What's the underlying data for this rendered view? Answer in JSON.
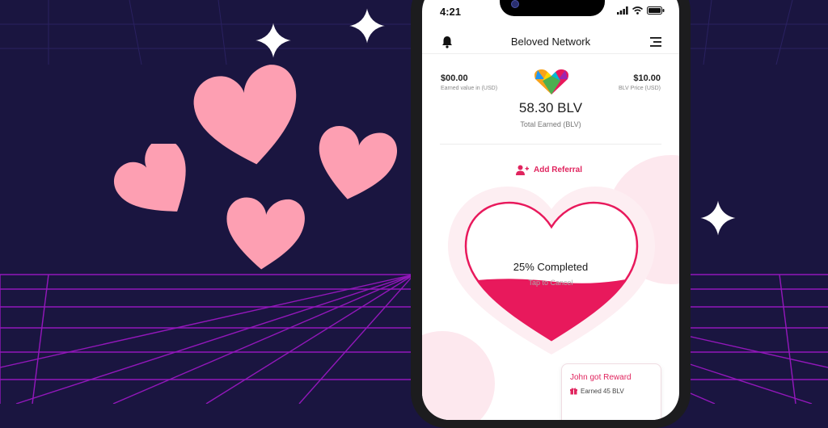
{
  "colors": {
    "background": "#1a1540",
    "grid": "#a018c8",
    "heart_pink": "#fd9fb2",
    "accent": "#e0245e",
    "fill": "#e8195c"
  },
  "status_bar": {
    "time": "4:21"
  },
  "header": {
    "title": "Beloved Network",
    "bell_icon": "bell-icon",
    "menu_icon": "hamburger-menu-icon"
  },
  "stats": {
    "earned_value": "$00.00",
    "earned_caption": "Earned value in (USD)",
    "blv_price": "$10.00",
    "blv_price_caption": "BLV Price (USD)",
    "total": "58.30 BLV",
    "total_caption": "Total Earned (BLV)"
  },
  "referral": {
    "label": "Add Referral",
    "icon": "add-user-icon"
  },
  "progress": {
    "title": "25% Completed",
    "subtitle": "Tap to Cancel",
    "fraction": 0.25
  },
  "reward_card": {
    "title": "John got Reward",
    "subtitle": "Earned 45 BLV",
    "icon": "gift-icon"
  }
}
